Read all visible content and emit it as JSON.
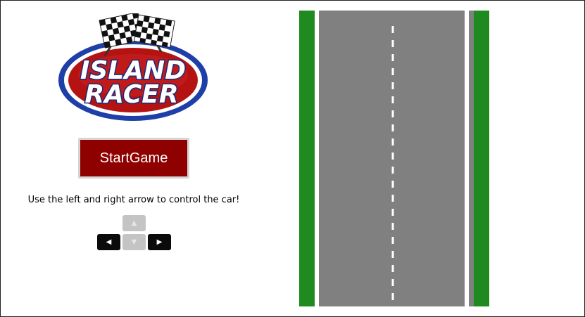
{
  "logo": {
    "line1": "ISLAND",
    "line2": "RACER",
    "colors": {
      "outer_ring": "#1f3fa8",
      "inner_ring": "#ffffff",
      "disc": "#b51212",
      "text_fill": "#ffffff",
      "text_outline": "#1a2a7a"
    },
    "flag_icon": "checkered-flags-icon"
  },
  "start_button": {
    "label": "StartGame",
    "color": "#8f0000"
  },
  "instruction": "Use the left and right arrow to control the car!",
  "keys": {
    "up": {
      "glyph": "▲",
      "icon": "arrow-up-icon",
      "enabled": false
    },
    "down": {
      "glyph": "▼",
      "icon": "arrow-down-icon",
      "enabled": false
    },
    "left": {
      "glyph": "◀",
      "icon": "arrow-left-icon",
      "enabled": true
    },
    "right": {
      "glyph": "▶",
      "icon": "arrow-right-icon",
      "enabled": true
    }
  },
  "road": {
    "grass_color": "#1f8a1f",
    "asphalt_color": "#808080",
    "edge_line_color": "#ffffff",
    "center_line_color": "#ffffff",
    "center_line_style": "dashed"
  }
}
